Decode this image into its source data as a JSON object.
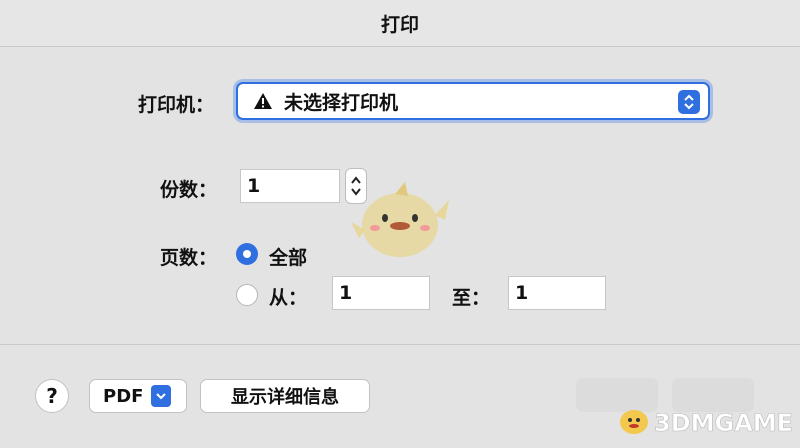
{
  "window": {
    "title": "打印"
  },
  "printer": {
    "label": "打印机：",
    "selected": "未选择打印机"
  },
  "copies": {
    "label": "份数：",
    "value": "1"
  },
  "pages": {
    "label": "页数：",
    "options": [
      {
        "label": "全部",
        "selected": true
      },
      {
        "label": "从：",
        "selected": false
      }
    ],
    "from_value": "1",
    "to_label": "至：",
    "to_value": "1"
  },
  "footer": {
    "help_label": "?",
    "pdf_label": "PDF",
    "details_label": "显示详细信息"
  },
  "colors": {
    "accent": "#2f6fe0"
  }
}
